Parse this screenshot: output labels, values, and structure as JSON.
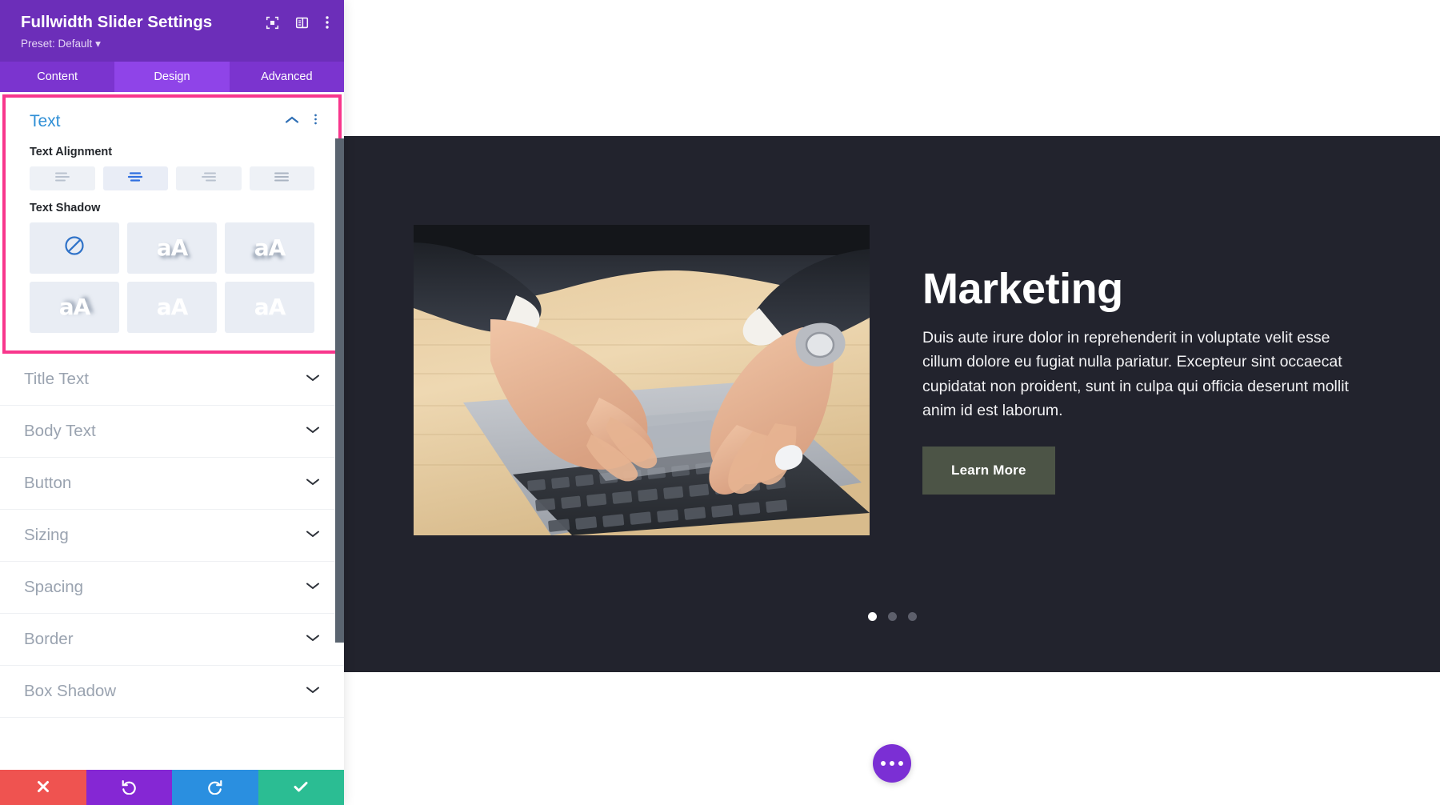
{
  "panel": {
    "title": "Fullwidth Slider Settings",
    "preset_label": "Preset: Default",
    "header_icons": [
      {
        "name": "focus-icon",
        "label": "Focus"
      },
      {
        "name": "layout-panel-icon",
        "label": "Panel Layout"
      },
      {
        "name": "more-vertical-icon",
        "label": "More Options"
      }
    ],
    "tabs": [
      {
        "label": "Content",
        "active": false
      },
      {
        "label": "Design",
        "active": true
      },
      {
        "label": "Advanced",
        "active": false
      }
    ],
    "open_section": {
      "title": "Text",
      "collapse_icon": "chevron-up-icon",
      "options_icon": "more-vertical-icon",
      "fields": [
        {
          "label": "Text Alignment",
          "type": "icon-toggle-group",
          "options": [
            {
              "name": "align-left",
              "active": false
            },
            {
              "name": "align-center",
              "active": true
            },
            {
              "name": "align-right",
              "active": false
            },
            {
              "name": "align-justify",
              "active": false
            }
          ]
        },
        {
          "label": "Text Shadow",
          "type": "preset-grid",
          "options": [
            {
              "name": "shadow-none",
              "glyph": "none",
              "active": true
            },
            {
              "name": "shadow-bottom-right",
              "glyph": "aA",
              "active": false
            },
            {
              "name": "shadow-bottom-right-soft",
              "glyph": "aA",
              "active": false
            },
            {
              "name": "shadow-bottom-left",
              "glyph": "aA",
              "active": false
            },
            {
              "name": "shadow-outline",
              "glyph": "aA",
              "active": false
            },
            {
              "name": "shadow-top-right",
              "glyph": "aA",
              "active": false
            }
          ]
        }
      ]
    },
    "sections": [
      {
        "label": "Title Text",
        "expanded": false
      },
      {
        "label": "Body Text",
        "expanded": false
      },
      {
        "label": "Button",
        "expanded": false
      },
      {
        "label": "Sizing",
        "expanded": false
      },
      {
        "label": "Spacing",
        "expanded": false
      },
      {
        "label": "Border",
        "expanded": false
      },
      {
        "label": "Box Shadow",
        "expanded": false
      }
    ],
    "actions": [
      {
        "name": "cancel-button",
        "icon": "close-icon",
        "color": "#ef5350"
      },
      {
        "name": "undo-button",
        "icon": "undo-icon",
        "color": "#8527d4"
      },
      {
        "name": "redo-button",
        "icon": "redo-icon",
        "color": "#2a8fe0"
      },
      {
        "name": "save-button",
        "icon": "check-icon",
        "color": "#2bbd93"
      }
    ],
    "colors": {
      "header_bg": "#6c2eb9",
      "tabs_bg": "#7b34cf",
      "tab_active_bg": "#8f44e8",
      "highlight_outline": "#f8368c",
      "section_title": "#2f8fd6"
    }
  },
  "preview": {
    "slide": {
      "title": "Marketing",
      "body": "Duis aute irure dolor in reprehenderit in voluptate velit esse cillum dolore eu fugiat nulla pariatur. Excepteur sint occaecat cupidatat non proident, sunt in culpa qui officia deserunt mollit anim id est laborum.",
      "button_label": "Learn More",
      "image_alt": "Hands typing on a laptop keyboard on a wooden desk",
      "background_color": "#22232d",
      "button_color": "#4c5446"
    },
    "dots": [
      {
        "active": true
      },
      {
        "active": false
      },
      {
        "active": false
      }
    ],
    "fab": {
      "name": "page-settings-fab",
      "icon": "ellipsis-icon",
      "color": "#7b2fd4"
    }
  }
}
